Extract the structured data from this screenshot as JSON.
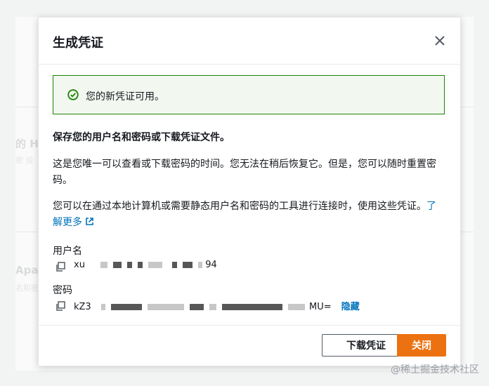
{
  "background": {
    "ghost_text_1": "的 H",
    "ghost_sub_1": "密 设",
    "ghost_text_2": "Apac",
    "ghost_sub_2": "名和密"
  },
  "modal": {
    "title": "生成凭证",
    "alert": {
      "text": "您的新凭证可用。",
      "icon": "check-circle-icon"
    },
    "heading": "保存您的用户名和密码或下载凭证文件。",
    "paragraph1": "这是您唯一可以查看或下载密码的时间。您无法在稍后恢复它。但是，您可以随时重置密码。",
    "paragraph2_before_link": "您可以在通过本地计算机或需要静态用户名和密码的工具进行连接时，使用这些凭证。",
    "learn_more": "了解更多",
    "username": {
      "label": "用户名",
      "prefix": "xu",
      "suffix": "94"
    },
    "password": {
      "label": "密码",
      "prefix": "kZ3",
      "suffix": "MU=",
      "hide_label": "隐藏"
    },
    "buttons": {
      "download": "下载凭证",
      "close": "关闭"
    }
  },
  "watermark": "@稀土掘金技术社区",
  "colors": {
    "primary": "#ec7211",
    "link": "#0073bb",
    "success": "#1d8102"
  }
}
